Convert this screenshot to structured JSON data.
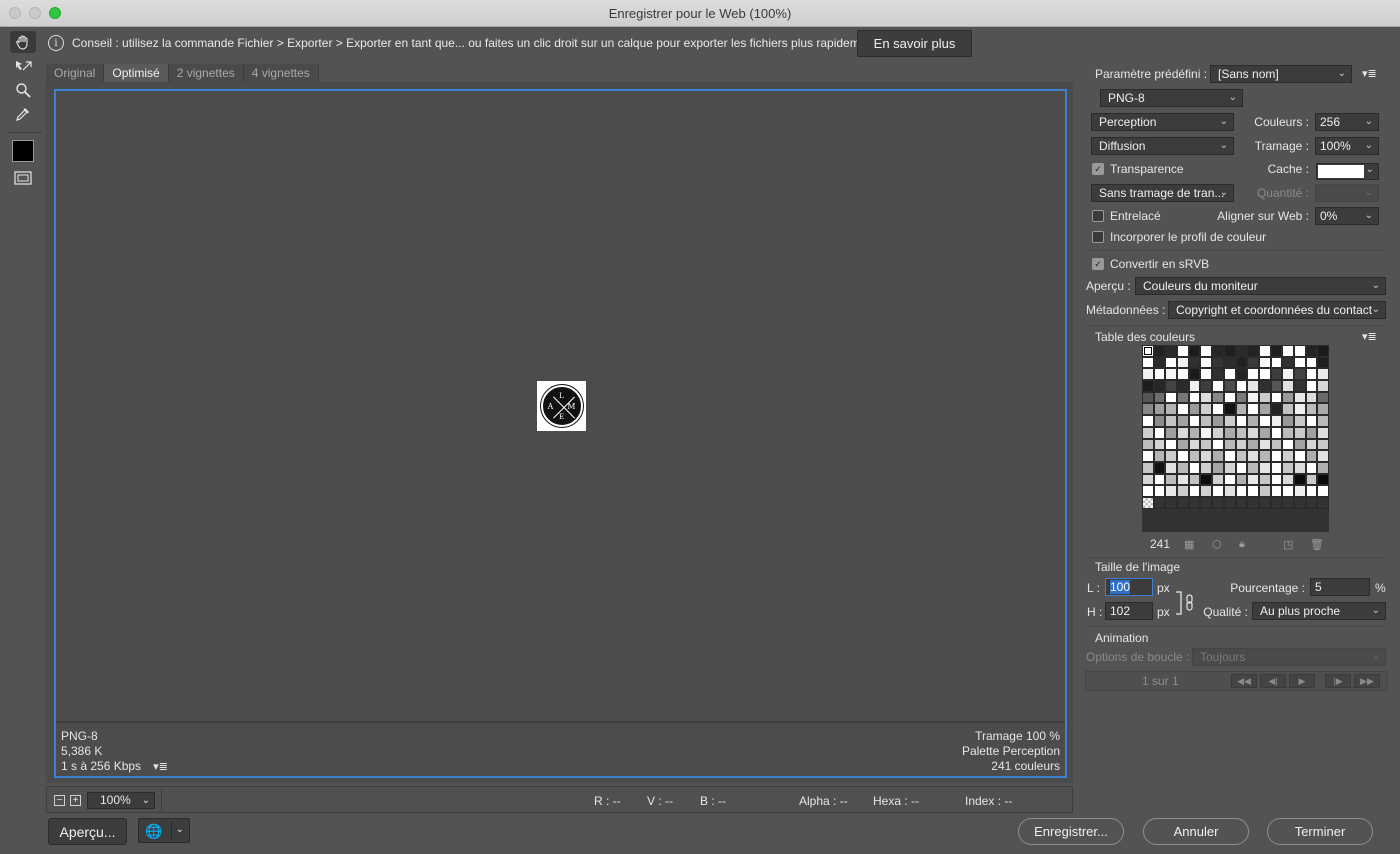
{
  "window": {
    "title": "Enregistrer pour le Web (100%)"
  },
  "hint": {
    "text": "Conseil : utilisez la commande Fichier > Exporter > Exporter en tant que... ou faites un clic droit sur un calque pour exporter les fichiers plus rapidement.",
    "learn_more": "En savoir plus"
  },
  "tabs": [
    "Original",
    "Optimisé",
    "2 vignettes",
    "4 vignettes"
  ],
  "image_info": {
    "format": "PNG-8",
    "size": "5,386 K",
    "speed": "1 s à 256 Kbps",
    "dither": "Tramage 100 %",
    "palette": "Palette Perception",
    "colors": "241 couleurs"
  },
  "logo_text": {
    "top": "DEPUTES LEZO",
    "l": "L",
    "a": "A",
    "m": "M",
    "e": "E",
    "bottom": "ALE DE LOGO"
  },
  "statusbar": {
    "zoom": "100%",
    "r": "R : --",
    "v": "V : --",
    "b": "B : --",
    "alpha": "Alpha : --",
    "hexa": "Hexa : --",
    "index": "Index : --"
  },
  "buttons": {
    "preview": "Aperçu...",
    "save": "Enregistrer...",
    "cancel": "Annuler",
    "done": "Terminer"
  },
  "settings": {
    "preset_label": "Paramètre prédéfini :",
    "preset_value": "[Sans nom]",
    "format": "PNG-8",
    "reduction": "Perception",
    "colors_label": "Couleurs :",
    "colors_value": "256",
    "dither_algo": "Diffusion",
    "dither_label": "Tramage :",
    "dither_value": "100%",
    "transparency_label": "Transparence",
    "transparency_checked": true,
    "matte_label": "Cache :",
    "transparency_dither": "Sans tramage de tran...",
    "amount_label": "Quantité :",
    "interlaced_label": "Entrelacé",
    "interlaced_checked": false,
    "websnap_label": "Aligner sur Web :",
    "websnap_value": "0%",
    "embed_profile_label": "Incorporer le profil de couleur",
    "embed_profile_checked": false,
    "convert_srgb_label": "Convertir en sRVB",
    "convert_srgb_checked": true,
    "preview_label": "Aperçu :",
    "preview_value": "Couleurs du moniteur",
    "metadata_label": "Métadonnées :",
    "metadata_value": "Copyright et coordonnées du contact"
  },
  "color_table": {
    "title": "Table des couleurs",
    "count": "241",
    "swatches": [
      "#1a1a1a",
      "#222222",
      "#2b2b2b",
      "#ffffff",
      "#1c1c1c",
      "#ffffff",
      "#262626",
      "#1f1f1f",
      "#2a2a2a",
      "#232323",
      "#ffffff",
      "#1e1e1e",
      "#ffffff",
      "#ffffff",
      "#242424",
      "#1b1b1b",
      "#ffffff",
      "#2a2a2a",
      "#ffffff",
      "#f2f2f2",
      "#303030",
      "#ffffff",
      "#353535",
      "#2c2c2c",
      "#202020",
      "#3a3a3a",
      "#fafafa",
      "#ffffff",
      "#303030",
      "#ffffff",
      "#ffffff",
      "#1e1e1e",
      "#f0f0f0",
      "#ffffff",
      "#f7f7f7",
      "#ffffff",
      "#1b1b1b",
      "#ffffff",
      "#2f2f2f",
      "#ffffff",
      "#232323",
      "#ffffff",
      "#ffffff",
      "#3d3d3d",
      "#f3f3f3",
      "#444444",
      "#ffffff",
      "#ebebeb",
      "#1d1d1d",
      "#262626",
      "#444444",
      "#2a2a2a",
      "#f0f0f0",
      "#3d3d3d",
      "#ffffff",
      "#4d4d4d",
      "#ffffff",
      "#e6e6e6",
      "#2f2f2f",
      "#555555",
      "#e0e0e0",
      "#343434",
      "#ffffff",
      "#d8d8d8",
      "#555555",
      "#6e6e6e",
      "#ffffff",
      "#777777",
      "#ffffff",
      "#dcdcdc",
      "#888888",
      "#ffffff",
      "#7a7a7a",
      "#f2f2f2",
      "#cccccc",
      "#ffffff",
      "#999999",
      "#e8e8e8",
      "#dddddd",
      "#6a6a6a",
      "#888888",
      "#a0a0a0",
      "#b5b5b5",
      "#ffffff",
      "#9b9b9b",
      "#cfcfcf",
      "#ffffff",
      "#111111",
      "#b3b3b3",
      "#ffffff",
      "#a5a5a5",
      "#222222",
      "#c2c2c2",
      "#f0f0f0",
      "#bdbdbd",
      "#a9a9a9",
      "#ffffff",
      "#8c8c8c",
      "#c4c4c4",
      "#a3a3a3",
      "#ffffff",
      "#bfbfbf",
      "#9a9a9a",
      "#cccccc",
      "#ffffff",
      "#b0b0b0",
      "#ffffff",
      "#ededed",
      "#979797",
      "#c8c8c8",
      "#ffffff",
      "#b9b9b9",
      "#cdcdcd",
      "#ffffff",
      "#9f9f9f",
      "#dadada",
      "#b2b2b2",
      "#f5f5f5",
      "#d2d2d2",
      "#ababab",
      "#c0c0c0",
      "#d9d9d9",
      "#a7a7a7",
      "#ffffff",
      "#bbbbbb",
      "#cacaca",
      "#a1a1a1",
      "#dedede",
      "#bcbcbc",
      "#d4d4d4",
      "#ffffff",
      "#a8a8a8",
      "#d7d7d7",
      "#c6c6c6",
      "#ffffff",
      "#b7b7b7",
      "#d0d0d0",
      "#ababab",
      "#e3e3e3",
      "#c1c1c1",
      "#ffffff",
      "#a2a2a2",
      "#d5d5d5",
      "#c9c9c9",
      "#ffffff",
      "#b4b4b4",
      "#cbcbcb",
      "#ffffff",
      "#bebebe",
      "#d8d8d8",
      "#aeaeae",
      "#ffffff",
      "#c3c3c3",
      "#dfdfdf",
      "#b6b6b6",
      "#ffffff",
      "#cecece",
      "#ffffff",
      "#adadad",
      "#e1e1e1",
      "#c5c5c5",
      "#121212",
      "#e2e2e2",
      "#b8b8b8",
      "#ffffff",
      "#cfcfcf",
      "#a6a6a6",
      "#d3d3d3",
      "#ffffff",
      "#bababa",
      "#e4e4e4",
      "#ffffff",
      "#c7c7c7",
      "#dbdbdb",
      "#ffffff",
      "#afafaf",
      "#d6d6d6",
      "#ffffff",
      "#bdbdbd",
      "#e5e5e5",
      "#c2c2c2",
      "#0d0d0d",
      "#d1d1d1",
      "#ffffff",
      "#b1b1b1",
      "#e9e9e9",
      "#c5c5c5",
      "#ffffff",
      "#d9d9d9",
      "#0b0b0b",
      "#cacaca",
      "#0a0a0a",
      "#ffffff",
      "#ffffff",
      "#e7e7e7",
      "#cccccc",
      "#ffffff",
      "#d2d2d2",
      "#ffffff",
      "#e0e0e0",
      "#ffffff",
      "#ffffff",
      "#c8c8c8",
      "#ffffff",
      "#ffffff",
      "#ededed",
      "#ffffff",
      "#ffffff",
      "#f8f8f8",
      "#333333",
      "#333333",
      "#333333",
      "#333333",
      "#333333",
      "#333333",
      "#333333",
      "#333333",
      "#333333",
      "#333333",
      "#333333",
      "#333333",
      "#333333",
      "#333333",
      "#333333"
    ]
  },
  "image_size": {
    "title": "Taille de l'image",
    "width_label": "L :",
    "width_value": "100",
    "height_label": "H :",
    "height_value": "102",
    "unit": "px",
    "percent_label": "Pourcentage :",
    "percent_value": "5",
    "percent_unit": "%",
    "quality_label": "Qualité :",
    "quality_value": "Au plus proche"
  },
  "animation": {
    "title": "Animation",
    "loop_label": "Options de boucle :",
    "loop_value": "Toujours",
    "frame": "1 sur 1"
  },
  "colors": {
    "accent": "#3b82d0",
    "background": "#535353"
  }
}
